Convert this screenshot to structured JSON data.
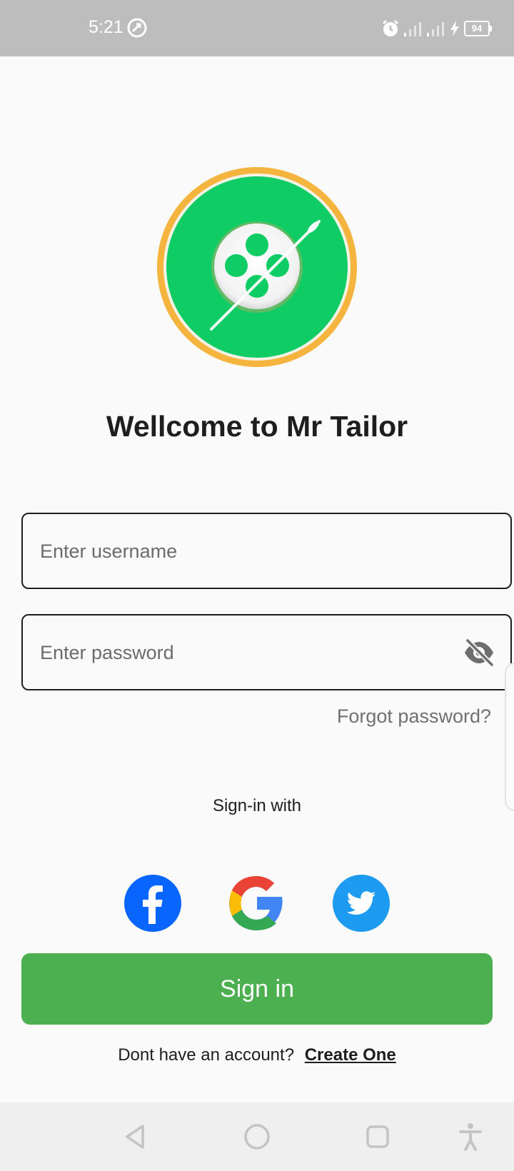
{
  "status_bar": {
    "time": "5:21",
    "battery": "94"
  },
  "app": {
    "title": "Wellcome to Mr Tailor"
  },
  "form": {
    "username_placeholder": "Enter username",
    "password_placeholder": "Enter password",
    "forgot_password": "Forgot password?"
  },
  "social": {
    "label": "Sign-in with",
    "buttons": [
      "facebook-icon",
      "google-icon",
      "twitter-icon"
    ]
  },
  "actions": {
    "signin_label": "Sign in",
    "no_account_text": "Dont have an account?",
    "create_link": "Create One"
  },
  "colors": {
    "primary_green": "#4caf50",
    "logo_green": "#10cc65",
    "logo_ring": "#f5b43e",
    "facebook_blue": "#0866ff",
    "twitter_blue": "#1d9bf0",
    "status_bar_bg": "#bdbdbd"
  },
  "nav_bar": {
    "buttons": [
      "back-icon",
      "home-icon",
      "recents-icon",
      "accessibility-icon"
    ]
  }
}
